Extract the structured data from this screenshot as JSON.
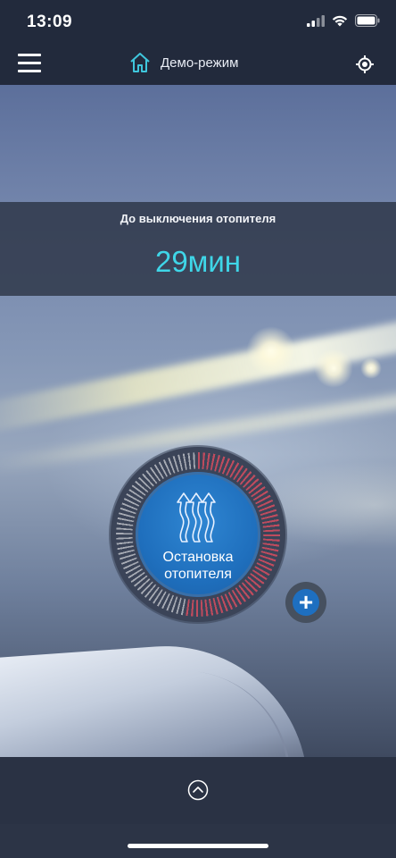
{
  "status_bar": {
    "time": "13:09",
    "icons": [
      "cellular-signal-icon",
      "wifi-icon",
      "battery-icon"
    ]
  },
  "nav": {
    "menu_icon": "hamburger-menu-icon",
    "home_icon": "home-icon",
    "title": "Демо-режим",
    "locate_icon": "location-target-icon"
  },
  "info": {
    "label": "До выключения отопителя",
    "value": "29мин"
  },
  "control": {
    "icon": "heat-waves-icon",
    "button_label": "Остановка отопителя",
    "add_icon": "plus-icon",
    "add_label": "+"
  },
  "bottom": {
    "expand_icon": "chevron-up-icon"
  },
  "colors": {
    "accent_cyan": "#3fd6e8",
    "button_blue": "#1f6fbd",
    "dial_red": "#c0465a",
    "bar_dark": "#222a3c"
  }
}
